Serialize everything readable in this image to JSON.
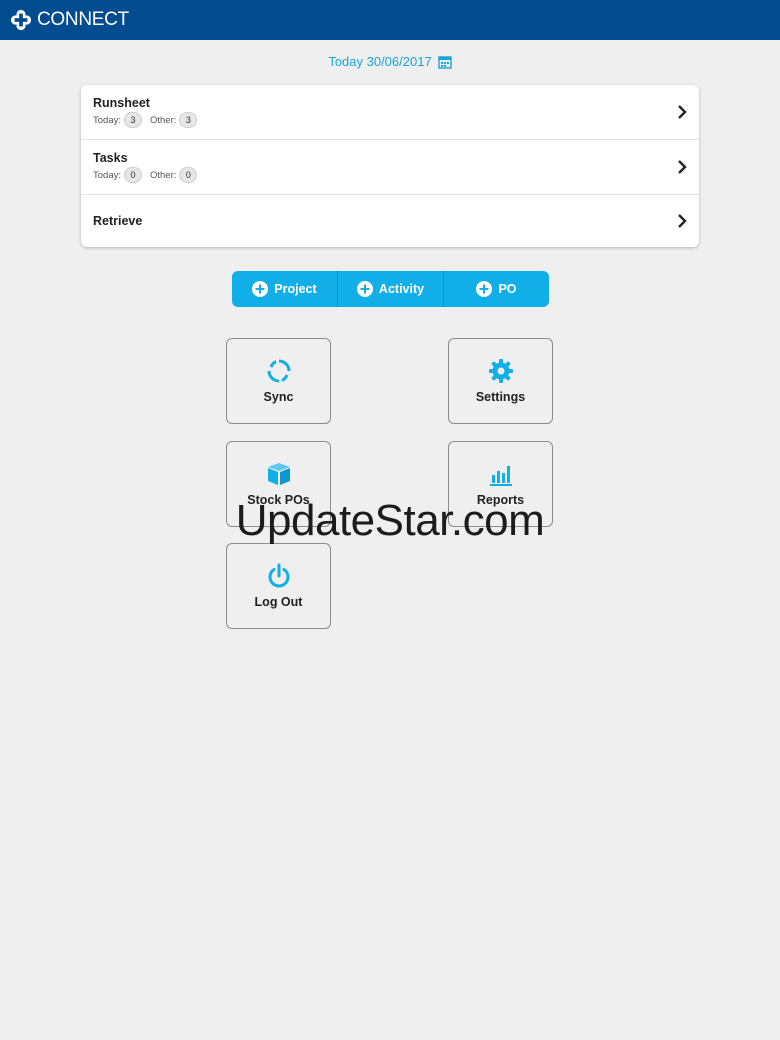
{
  "appbar": {
    "title": "CONNECT",
    "logo_icon": "plus-cross-icon",
    "color": "#034c8f"
  },
  "date": {
    "label": "Today 30/06/2017",
    "icon": "calendar-icon"
  },
  "list": {
    "runsheet": {
      "label": "Runsheet",
      "today_label": "Today:",
      "today_count": "3",
      "other_label": "Other:",
      "other_count": "3"
    },
    "tasks": {
      "label": "Tasks",
      "today_label": "Today:",
      "today_count": "0",
      "other_label": "Other:",
      "other_count": "0"
    },
    "retrieve": {
      "label": "Retrieve"
    }
  },
  "segment": {
    "color": "#12aee8",
    "project": "Project",
    "activity": "Activity",
    "po": "PO"
  },
  "tiles": {
    "sync": "Sync",
    "settings": "Settings",
    "stock": "Stock POs",
    "reports": "Reports",
    "logout": "Log Out",
    "icon_color": "#12aee8"
  },
  "watermark": "UpdateStar.com"
}
